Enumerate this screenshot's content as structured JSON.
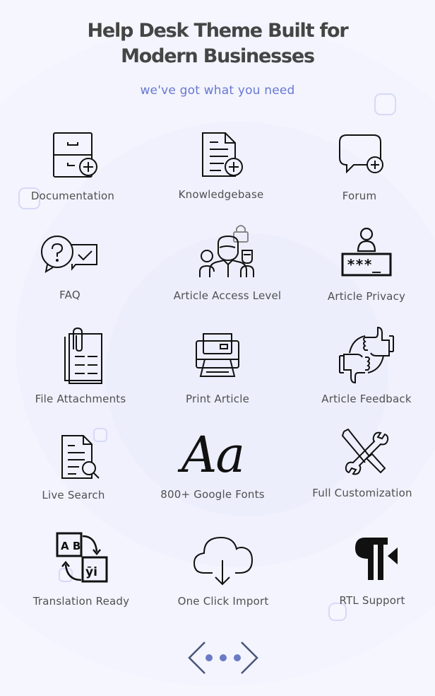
{
  "header": {
    "title_line1": "Help Desk Theme Built for",
    "title_line2": "Modern Businesses",
    "subtitle": "we've got what you need"
  },
  "colors": {
    "background": "#f6f7fe",
    "title": "#454545",
    "subtitle": "#6878d0",
    "label": "#505050",
    "icon": "#111111",
    "nav_arrow": "#4a5578",
    "nav_dot": "#6a7ac4",
    "deco_square": "#d7d9f7"
  },
  "features": [
    {
      "label": "Documentation",
      "icon": "file-cabinet-plus-icon"
    },
    {
      "label": "Knowledgebase",
      "icon": "document-plus-icon"
    },
    {
      "label": "Forum",
      "icon": "chat-bubble-plus-icon"
    },
    {
      "label": "FAQ",
      "icon": "question-chat-icon"
    },
    {
      "label": "Article Access Level",
      "icon": "team-lock-icon"
    },
    {
      "label": "Article Privacy",
      "icon": "user-password-icon"
    },
    {
      "label": "File Attachments",
      "icon": "paperclip-documents-icon"
    },
    {
      "label": "Print Article",
      "icon": "printer-icon"
    },
    {
      "label": "Article Feedback",
      "icon": "thumbs-up-down-icon"
    },
    {
      "label": "Live Search",
      "icon": "document-search-icon"
    },
    {
      "label": "800+ Google Fonts",
      "icon": "typography-aa-icon",
      "glyph": "Aa"
    },
    {
      "label": "Full Customization",
      "icon": "wrench-screwdriver-icon"
    },
    {
      "label": "Translation Ready",
      "icon": "translation-ab-icon",
      "glyph_a": "A B",
      "glyph_b": "ӯі"
    },
    {
      "label": "One Click Import",
      "icon": "cloud-download-icon"
    },
    {
      "label": "RTL Support",
      "icon": "rtl-pilcrow-icon",
      "glyph": "¶"
    }
  ],
  "navigation": {
    "prev_icon": "chevron-left-icon",
    "next_icon": "chevron-right-icon",
    "dots": 3
  }
}
